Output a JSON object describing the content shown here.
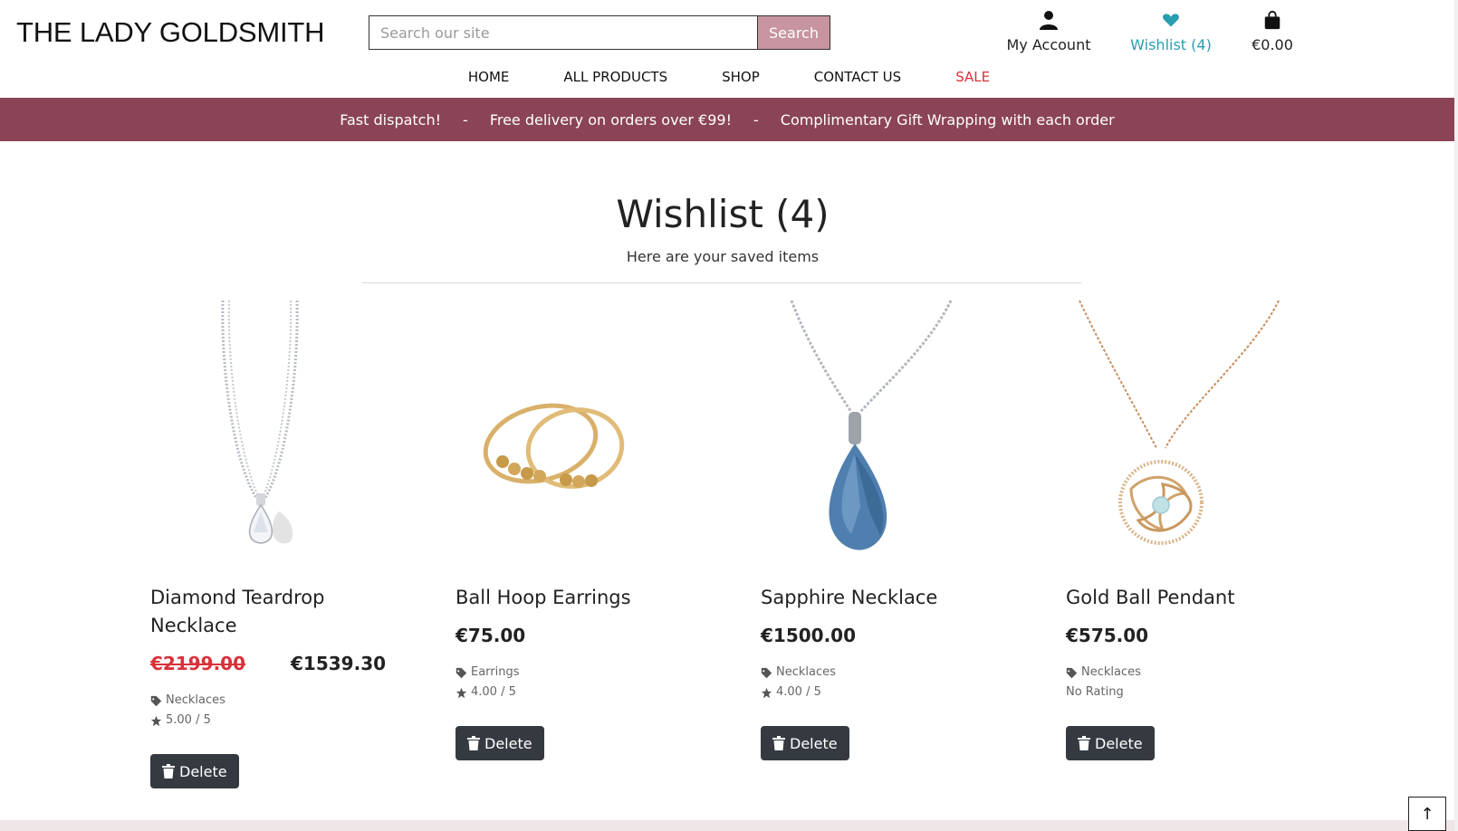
{
  "header": {
    "logo": "THE LADY GOLDSMITH",
    "search_placeholder": "Search our site",
    "search_button": "Search",
    "account_label": "My Account",
    "wishlist_label": "Wishlist (4)",
    "cart_label": "€0.00",
    "wishlist_color": "#2a9db0"
  },
  "nav": {
    "items": [
      "HOME",
      "ALL PRODUCTS",
      "SHOP",
      "CONTACT US",
      "SALE"
    ],
    "sale_color": "#d9313a"
  },
  "banner": {
    "items": [
      "Fast dispatch!",
      "-",
      "Free delivery on orders over €99!",
      "-",
      "Complimentary Gift Wrapping with each order"
    ],
    "bg_color": "#8b4455"
  },
  "main": {
    "title": "Wishlist (4)",
    "subtitle": "Here are your saved items"
  },
  "products": [
    {
      "name": "Diamond Teardrop Necklace",
      "old_price": "€2199.00",
      "price": "€1539.30",
      "category": "Necklaces",
      "rating": "5.00 / 5",
      "delete_label": "Delete",
      "image_icon": "silver-diamond-teardrop-necklace"
    },
    {
      "name": "Ball Hoop Earrings",
      "price": "€75.00",
      "category": "Earrings",
      "rating": "4.00 / 5",
      "delete_label": "Delete",
      "image_icon": "gold-ball-hoop-earrings"
    },
    {
      "name": "Sapphire Necklace",
      "price": "€1500.00",
      "category": "Necklaces",
      "rating": "4.00 / 5",
      "delete_label": "Delete",
      "image_icon": "blue-sapphire-necklace"
    },
    {
      "name": "Gold Ball Pendant",
      "price": "€575.00",
      "category": "Necklaces",
      "rating": "No Rating",
      "delete_label": "Delete",
      "image_icon": "gold-ball-pendant"
    }
  ],
  "back_to_top": "↑"
}
